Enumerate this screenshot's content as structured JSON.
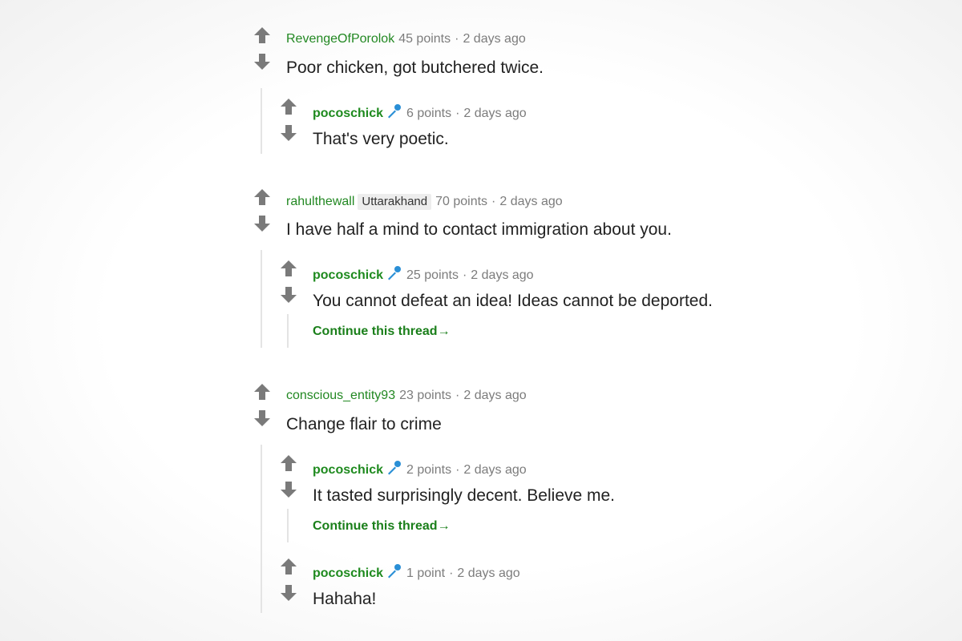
{
  "comments": [
    {
      "author": "RevengeOfPorolok",
      "points": "45 points",
      "time": "2 days ago",
      "text": "Poor chicken, got butchered twice.",
      "replies": [
        {
          "author": "pocoschick",
          "points": "6 points",
          "time": "2 days ago",
          "text": "That's very poetic."
        }
      ]
    },
    {
      "author": "rahulthewall",
      "flair": "Uttarakhand",
      "points": "70 points",
      "time": "2 days ago",
      "text": "I have half a mind to contact immigration about you.",
      "replies": [
        {
          "author": "pocoschick",
          "points": "25 points",
          "time": "2 days ago",
          "text": "You cannot defeat an idea! Ideas cannot be deported.",
          "continue": "Continue this thread"
        }
      ]
    },
    {
      "author": "conscious_entity93",
      "points": "23 points",
      "time": "2 days ago",
      "text": "Change flair to crime",
      "replies": [
        {
          "author": "pocoschick",
          "points": "2 points",
          "time": "2 days ago",
          "text": "It tasted surprisingly decent. Believe me.",
          "continue": "Continue this thread"
        },
        {
          "author": "pocoschick",
          "points": "1 point",
          "time": "2 days ago",
          "text": "Hahaha!"
        }
      ]
    }
  ],
  "separator": "·",
  "continue_arrow": "→",
  "icons": {
    "upvote": "upvote-arrow-icon",
    "downvote": "downvote-arrow-icon",
    "op_badge": "microphone-icon"
  },
  "colors": {
    "author": "#228822",
    "op_author": "#1e8a1e",
    "meta": "#7c7c7c",
    "arrow": "#7a7a7a",
    "mic": "#2a8fd6"
  }
}
